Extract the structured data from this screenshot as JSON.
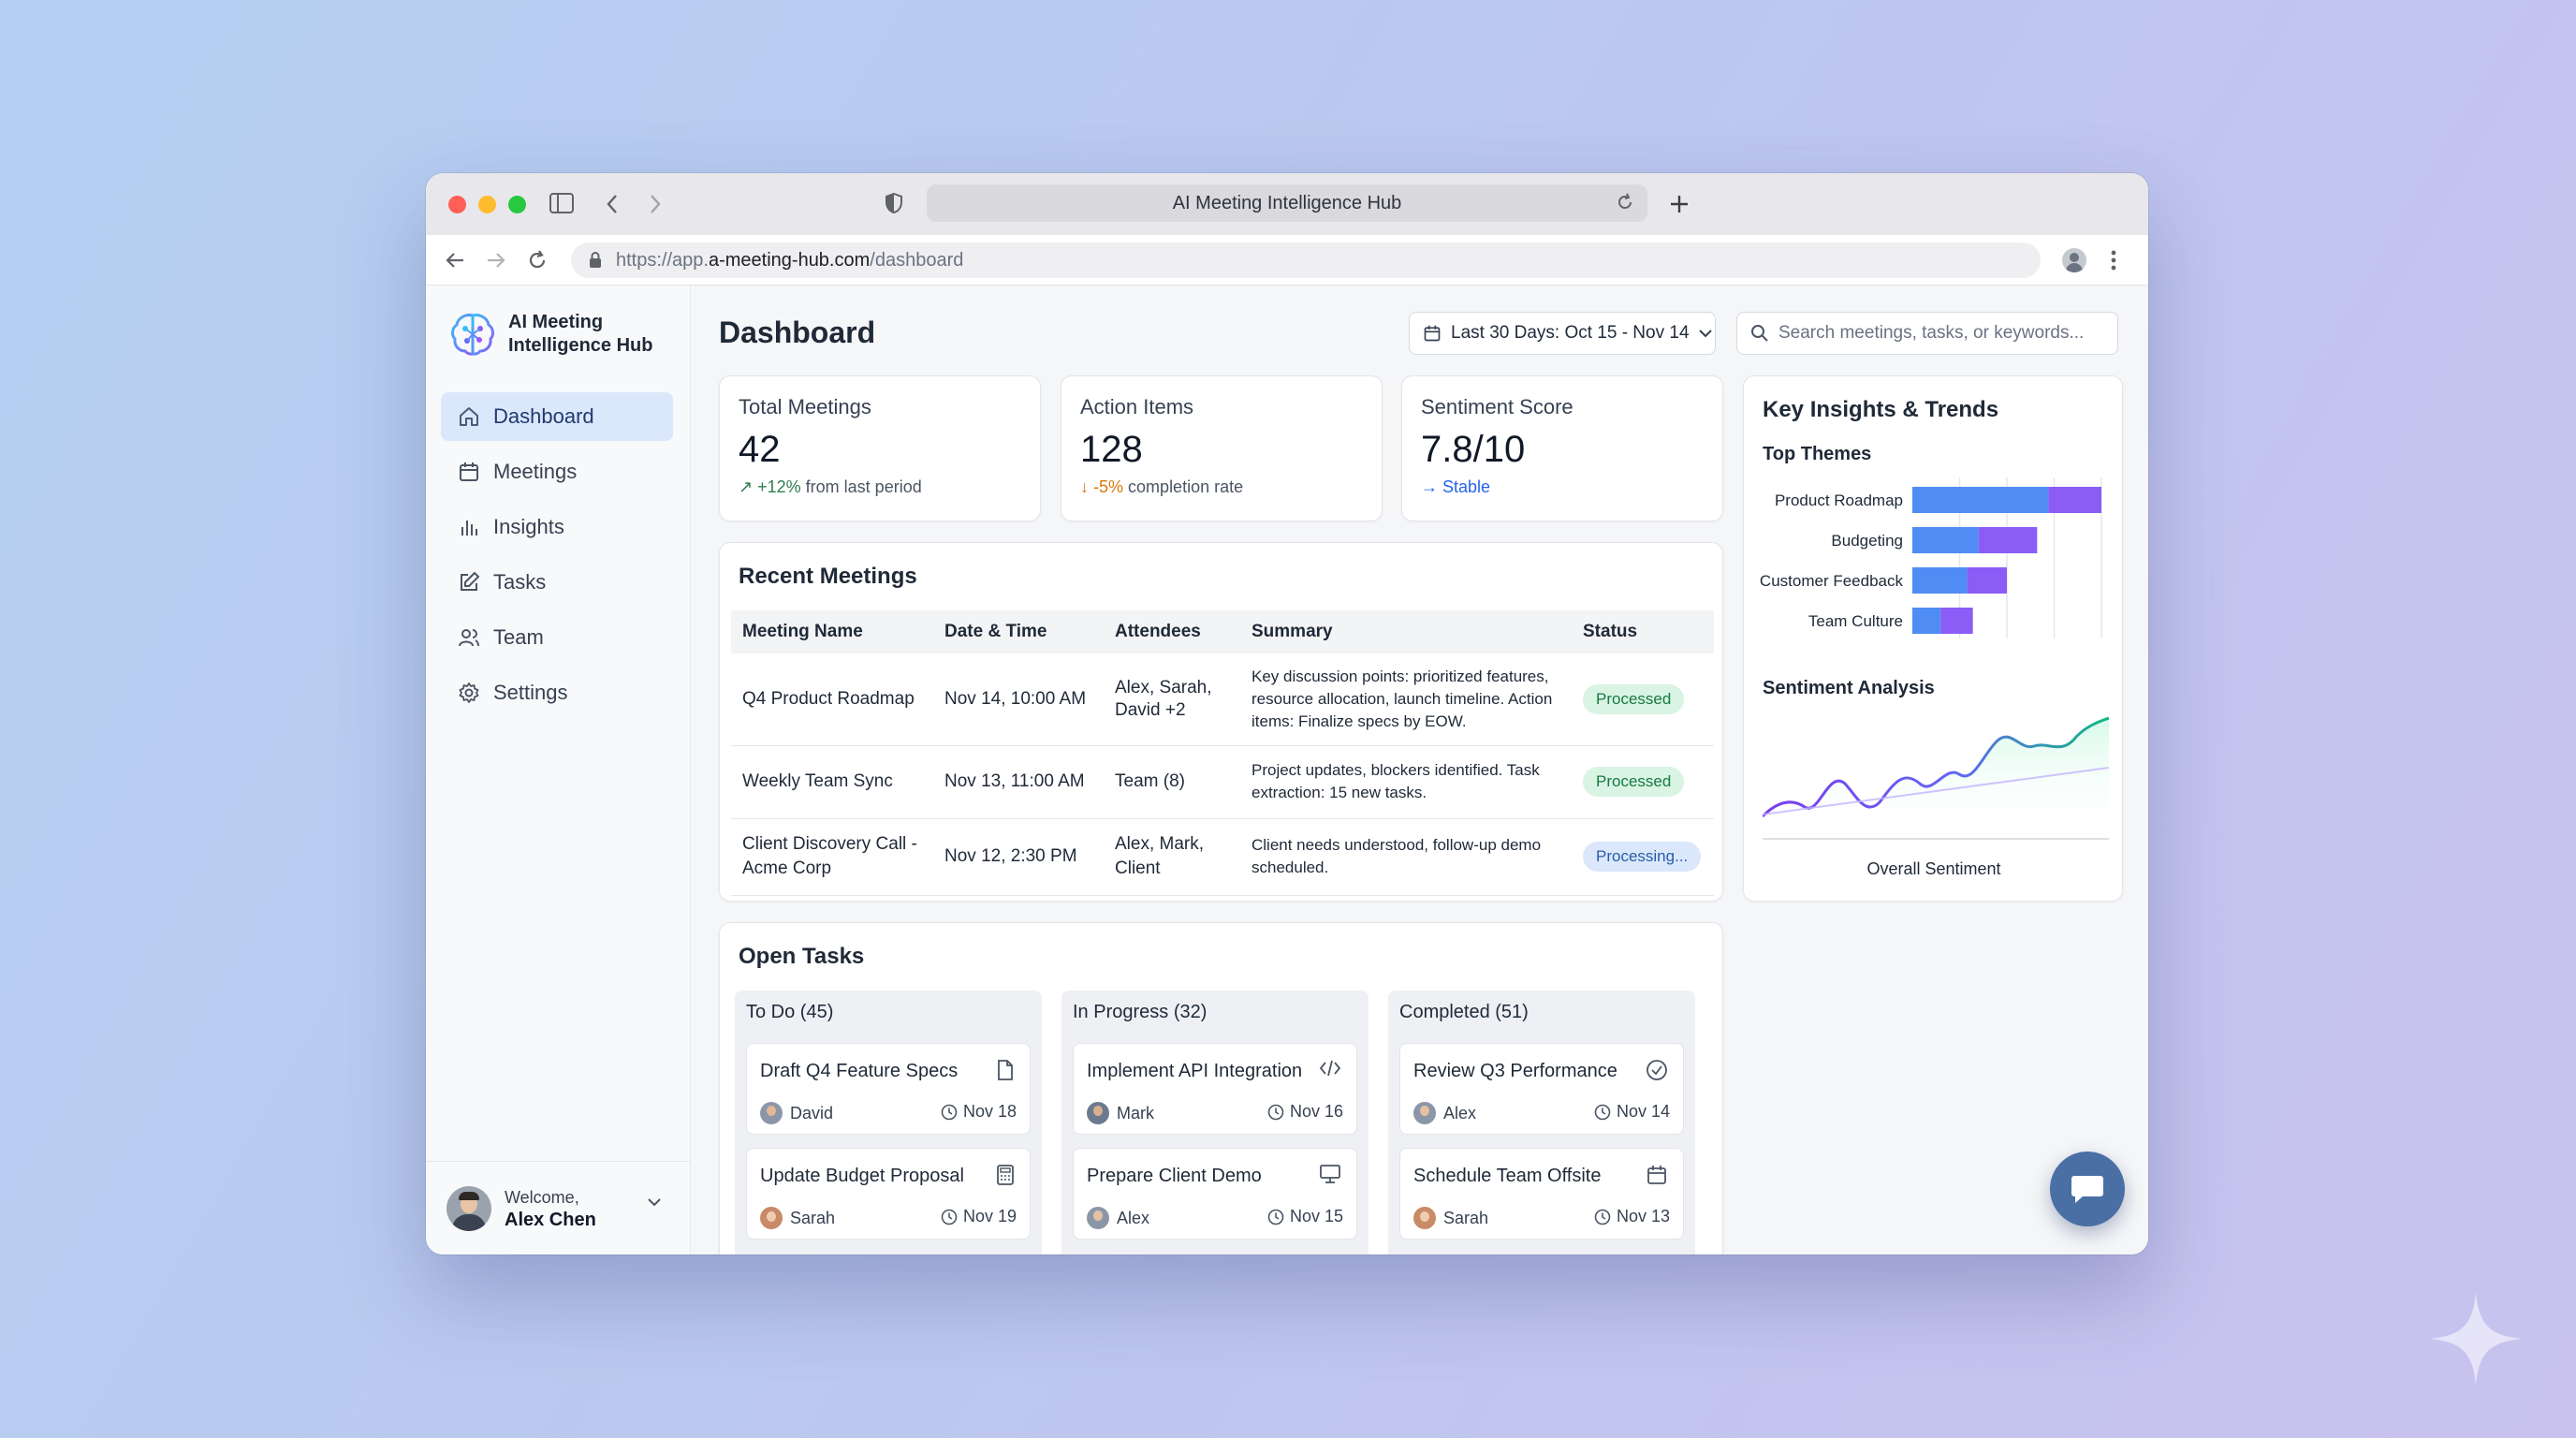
{
  "browser": {
    "tab_title": "AI Meeting Intelligence Hub",
    "url_prefix": "https://app.",
    "url_host": "a-meeting-hub.com",
    "url_path": "/dashboard"
  },
  "sidebar": {
    "app_name": "AI Meeting Intelligence Hub",
    "items": [
      {
        "label": "Dashboard",
        "icon": "home-icon",
        "active": true
      },
      {
        "label": "Meetings",
        "icon": "calendar-icon"
      },
      {
        "label": "Insights",
        "icon": "bar-chart-icon"
      },
      {
        "label": "Tasks",
        "icon": "edit-icon"
      },
      {
        "label": "Team",
        "icon": "users-icon"
      },
      {
        "label": "Settings",
        "icon": "gear-icon"
      }
    ],
    "user": {
      "greeting": "Welcome,",
      "name": "Alex Chen"
    }
  },
  "header": {
    "title": "Dashboard",
    "date_range": "Last 30 Days: Oct 15 - Nov 14",
    "search_placeholder": "Search meetings, tasks, or keywords..."
  },
  "stats": [
    {
      "label": "Total Meetings",
      "value": "42",
      "trend_value": "+12%",
      "trend_text": "from last period",
      "trend_color": "#2e7d4f",
      "arrow": "↗"
    },
    {
      "label": "Action Items",
      "value": "128",
      "trend_value": "-5%",
      "trend_text": "completion rate",
      "trend_color": "#d97706",
      "arrow": "↓"
    },
    {
      "label": "Sentiment Score",
      "value": "7.8/10",
      "trend_value": "Stable",
      "trend_text": "",
      "trend_color": "#2563eb",
      "arrow": "→"
    }
  ],
  "recent_meetings": {
    "title": "Recent Meetings",
    "columns": [
      "Meeting Name",
      "Date & Time",
      "Attendees",
      "Summary",
      "Status"
    ],
    "rows": [
      {
        "name": "Q4 Product Roadmap",
        "date": "Nov 14, 10:00 AM",
        "attendees": "Alex, Sarah, David +2",
        "summary": "Key discussion points: prioritized features, resource allocation, launch timeline. Action items: Finalize specs by EOW.",
        "status": "Processed"
      },
      {
        "name": "Weekly Team Sync",
        "date": "Nov 13, 11:00 AM",
        "attendees": "Team (8)",
        "summary": "Project updates, blockers identified. Task extraction: 15 new tasks.",
        "status": "Processed"
      },
      {
        "name": "Client Discovery Call - Acme Corp",
        "date": "Nov 12, 2:30 PM",
        "attendees": "Alex, Mark, Client",
        "summary": "Client needs understood, follow-up demo scheduled.",
        "status": "Processing..."
      }
    ]
  },
  "open_tasks": {
    "title": "Open Tasks",
    "columns": [
      {
        "title": "To Do (45)",
        "tasks": [
          {
            "title": "Draft Q4 Feature Specs",
            "icon": "document-icon",
            "user": "David",
            "date": "Nov 18"
          },
          {
            "title": "Update Budget Proposal",
            "icon": "calculator-icon",
            "user": "Sarah",
            "date": "Nov 19"
          }
        ]
      },
      {
        "title": "In Progress (32)",
        "tasks": [
          {
            "title": "Implement API Integration",
            "icon": "code-icon",
            "user": "Mark",
            "date": "Nov 16"
          },
          {
            "title": "Prepare Client Demo",
            "icon": "monitor-icon",
            "user": "Alex",
            "date": "Nov 15"
          }
        ]
      },
      {
        "title": "Completed (51)",
        "tasks": [
          {
            "title": "Review Q3 Performance",
            "icon": "check-circle-icon",
            "user": "Alex",
            "date": "Nov 14"
          },
          {
            "title": "Schedule Team Offsite",
            "icon": "calendar-icon",
            "user": "Sarah",
            "date": "Nov 13"
          }
        ]
      }
    ]
  },
  "insights": {
    "title": "Key Insights & Trends",
    "themes_title": "Top Themes",
    "themes": [
      {
        "label": "Product Roadmap",
        "a": 0.72,
        "b": 0.28
      },
      {
        "label": "Budgeting",
        "a": 0.35,
        "b": 0.31
      },
      {
        "label": "Customer Feedback",
        "a": 0.29,
        "b": 0.21
      },
      {
        "label": "Team Culture",
        "a": 0.15,
        "b": 0.17
      }
    ],
    "sentiment_title": "Sentiment Analysis",
    "sentiment_caption": "Overall Sentiment"
  },
  "colors": {
    "accent": "#4a6fa5",
    "bar_blue": "#4f8df5",
    "bar_purple": "#8b5cf6"
  }
}
